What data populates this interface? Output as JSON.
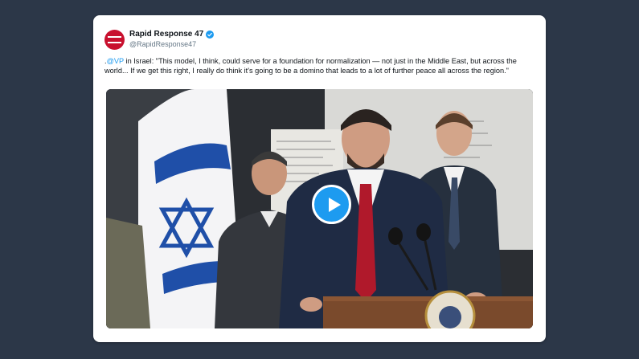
{
  "tweet": {
    "display_name": "Rapid Response 47",
    "handle": "@RapidResponse47",
    "text_prefix": ".",
    "mention": "@VP",
    "text_body": " in Israel: \"This model, I think, could serve for a foundation for normalization — not just in the Middle East, but across the world... If we get this right, I really do think it's going to be a domino that leads to a lot of further peace all across the region.\"",
    "verified_icon": "verified-badge-icon",
    "avatar_icon": "presidential-seal-avatar"
  },
  "media": {
    "type": "video",
    "play_icon": "play-icon"
  },
  "colors": {
    "background": "#2c3748",
    "link": "#1d9bf0",
    "avatar": "#c8102e"
  }
}
